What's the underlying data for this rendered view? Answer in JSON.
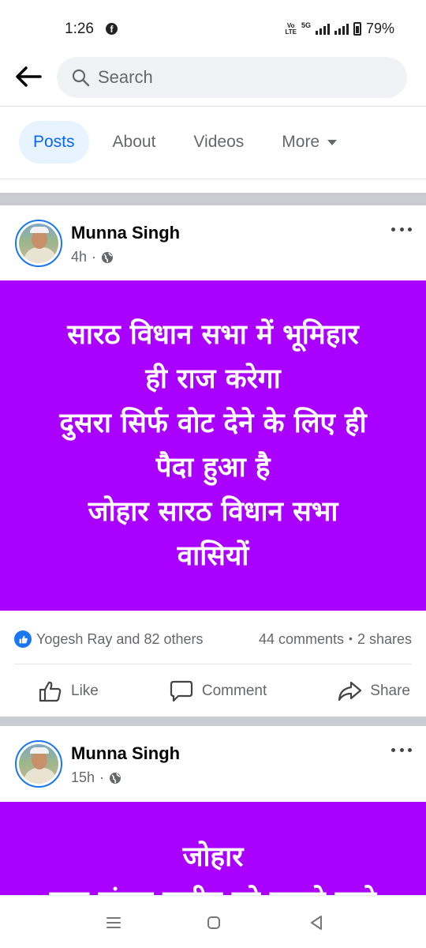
{
  "status_bar": {
    "time": "1:26",
    "fb_glyph": "f",
    "volte": "Vo\nLTE",
    "network": "5G",
    "battery": "79%"
  },
  "search": {
    "placeholder": "Search"
  },
  "tabs": [
    {
      "label": "Posts",
      "active": true
    },
    {
      "label": "About"
    },
    {
      "label": "Videos"
    },
    {
      "label": "More"
    }
  ],
  "posts": [
    {
      "author": "Munna Singh",
      "time": "4h",
      "privacy": "·",
      "text": "सारठ विधान सभा में भूमिहार\nही राज करेगा\nदुसरा सिर्फ वोट देने के लिए ही\nपैदा हुआ है\nजोहार सारठ विधान सभा\nवासियों",
      "reactions": "Yogesh Ray and 82 others",
      "comments": "44 comments",
      "sep": "•",
      "shares": "2 shares",
      "actions": {
        "like": "Like",
        "comment": "Comment",
        "share": "Share"
      }
    },
    {
      "author": "Munna Singh",
      "time": "15h",
      "privacy": "·",
      "text": "जोहार\nजल जंगल जमीन को बचाने वाले"
    }
  ],
  "colors": {
    "accent": "#0866ff",
    "banner": "#aa00ff",
    "tab_active_bg": "#e7f3ff"
  },
  "icons": [
    "back-arrow-icon",
    "search-icon",
    "globe-icon",
    "more-dots-icon",
    "like-icon",
    "comment-icon",
    "share-icon",
    "recent-apps-icon",
    "home-icon",
    "back-icon"
  ]
}
